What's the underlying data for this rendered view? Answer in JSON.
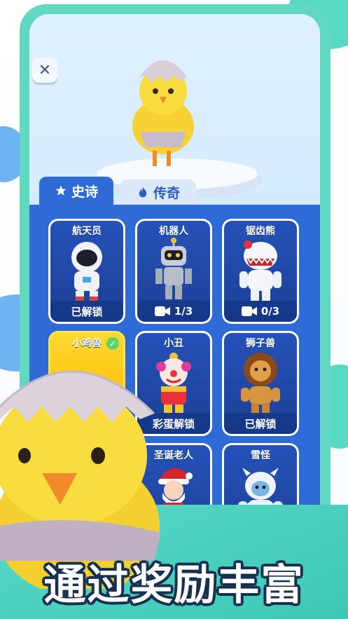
{
  "tabs": [
    {
      "label": "史诗",
      "icon": "star-icon",
      "active": true
    },
    {
      "label": "传奇",
      "icon": "flame-icon",
      "active": false
    }
  ],
  "characters": [
    {
      "name": "航天员",
      "status": "已解锁",
      "status_type": "unlocked"
    },
    {
      "name": "机器人",
      "status": "1/3",
      "status_type": "video"
    },
    {
      "name": "锯齿熊",
      "status": "0/3",
      "status_type": "video"
    },
    {
      "name": "小鸡兽",
      "status": "",
      "status_type": "selected"
    },
    {
      "name": "小丑",
      "status": "彩蛋解锁",
      "status_type": "easter"
    },
    {
      "name": "狮子兽",
      "status": "已解锁",
      "status_type": "unlocked"
    },
    {
      "name": "圣诞老人",
      "status": "",
      "status_type": "partial"
    },
    {
      "name": "雪怪",
      "status": "",
      "status_type": "partial"
    }
  ],
  "slogan": "通过奖励丰富",
  "colors": {
    "accent": "#2f6bd6",
    "frame": "#61d9c2",
    "selected": "#ffd92e"
  }
}
